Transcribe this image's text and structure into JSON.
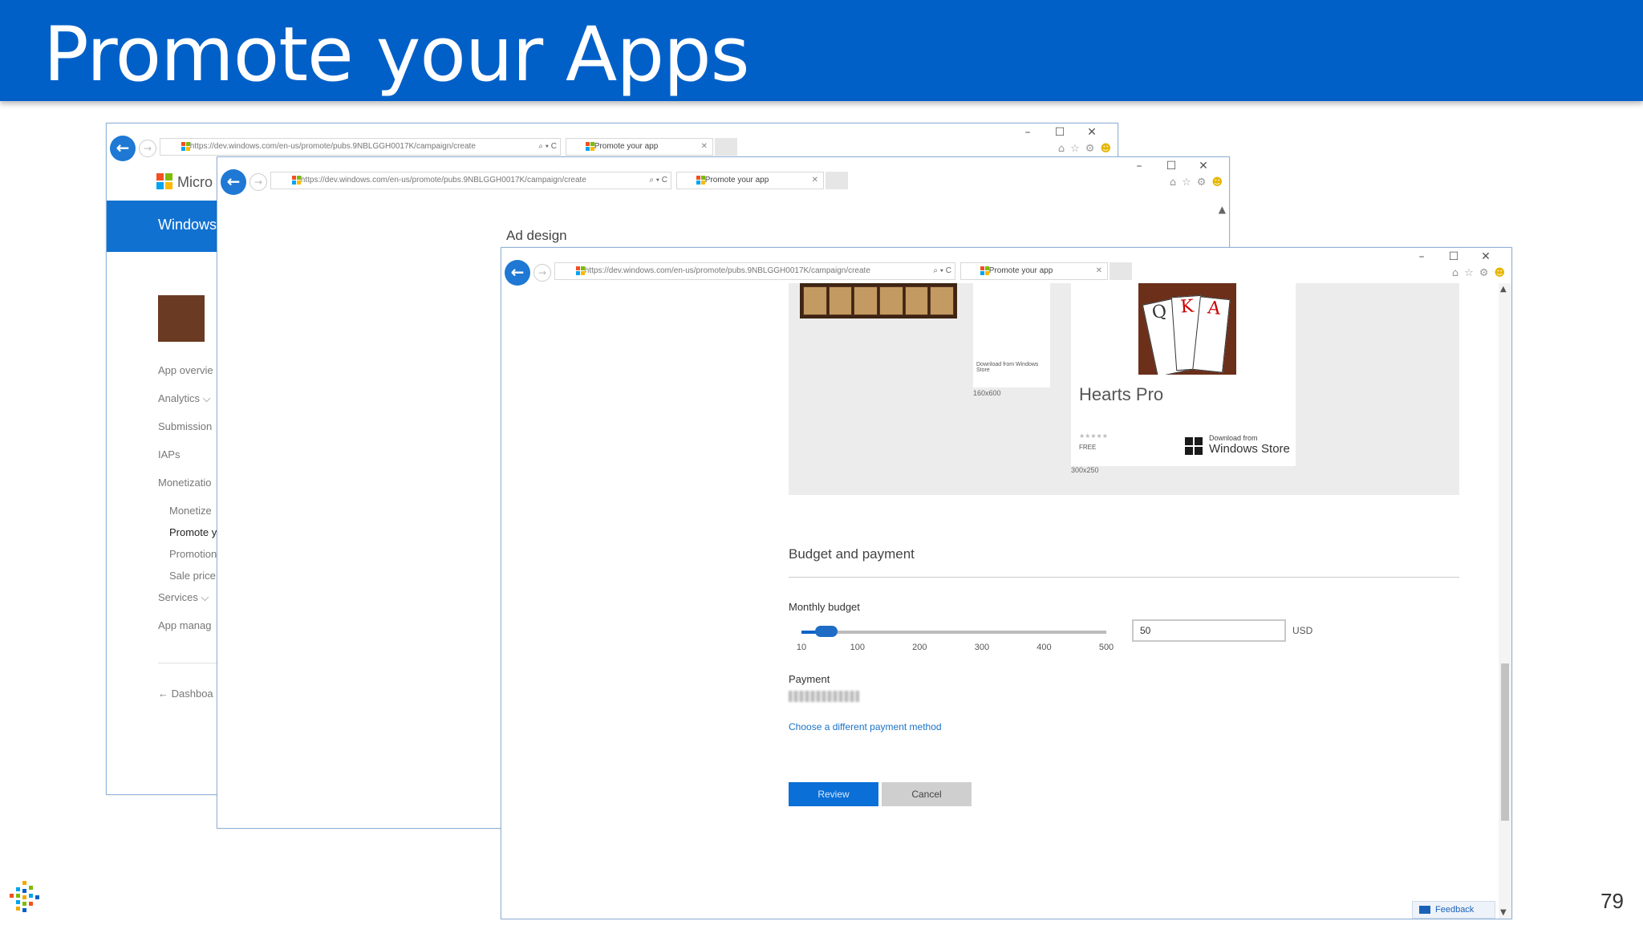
{
  "slide": {
    "title": "Promote your Apps",
    "page_number": "79"
  },
  "browser": {
    "url": "https://dev.windows.com/en-us/promote/pubs.9NBLGGH0017K/campaign/create",
    "tab_label": "Promote your app",
    "address_tools": "⌕ ▾ C"
  },
  "window_back": {
    "brand": "Micro",
    "banner": "Windows",
    "nav": {
      "app_overview": "App overvie",
      "analytics": "Analytics ⌵",
      "submissions": "Submission",
      "iaps": "IAPs",
      "monetization": "Monetizatio",
      "monetize": "Monetize",
      "promote": "Promote y",
      "promotions": "Promotion",
      "sale_pricing": "Sale price",
      "services": "Services ⌵",
      "app_management": "App manag",
      "dashboard": "← Dashboa"
    }
  },
  "window_middle": {
    "heading": "Ad design"
  },
  "window_front": {
    "preview": {
      "tall_ad_store": "Download from Windows Store",
      "tall_ad_size": "160x600",
      "app_name": "Hearts Pro",
      "rating": "★★★★★",
      "price": "FREE",
      "store_small": "Download from",
      "store_big": "Windows Store",
      "big_ad_size": "300x250"
    },
    "budget_section": {
      "title": "Budget and payment",
      "monthly_budget_label": "Monthly budget",
      "slider": {
        "min": 10,
        "max": 500,
        "value": 50
      },
      "ticks": [
        "10",
        "100",
        "200",
        "300",
        "400",
        "500"
      ],
      "budget_value": "50",
      "currency": "USD",
      "payment_label": "Payment",
      "change_payment_link": "Choose a different payment method",
      "review_button": "Review",
      "cancel_button": "Cancel"
    },
    "feedback": "Feedback"
  },
  "colors": {
    "header_blue": "#0060c8",
    "accent_blue": "#0a6fd6",
    "link_blue": "#1a73c8"
  }
}
